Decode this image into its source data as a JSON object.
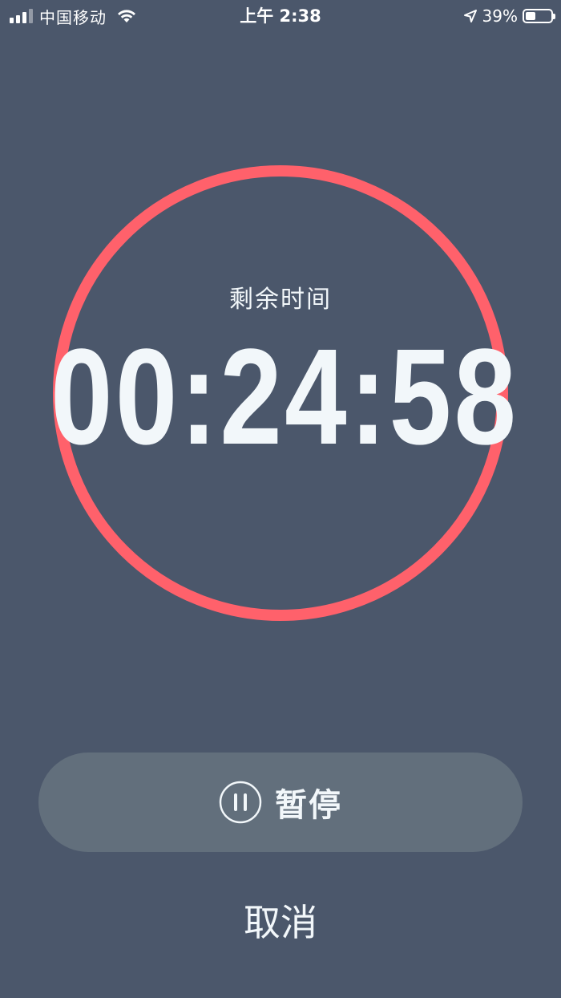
{
  "status_bar": {
    "carrier": "中国移动",
    "time": "上午 2:38",
    "battery": "39%",
    "battery_level": 0.39,
    "icons": [
      "signal-icon",
      "wifi-icon",
      "location-arrow-icon",
      "battery-icon"
    ]
  },
  "timer": {
    "label": "剩余时间",
    "time": "00:24:58",
    "ring_color": "#ff616b"
  },
  "actions": {
    "pause_label": "暂停",
    "pause_icon": "pause-circle-icon",
    "cancel_label": "取消"
  },
  "colors": {
    "background": "#4b576b",
    "button": "#626f7c",
    "text": "#f2f7fa",
    "accent": "#ff616b"
  }
}
